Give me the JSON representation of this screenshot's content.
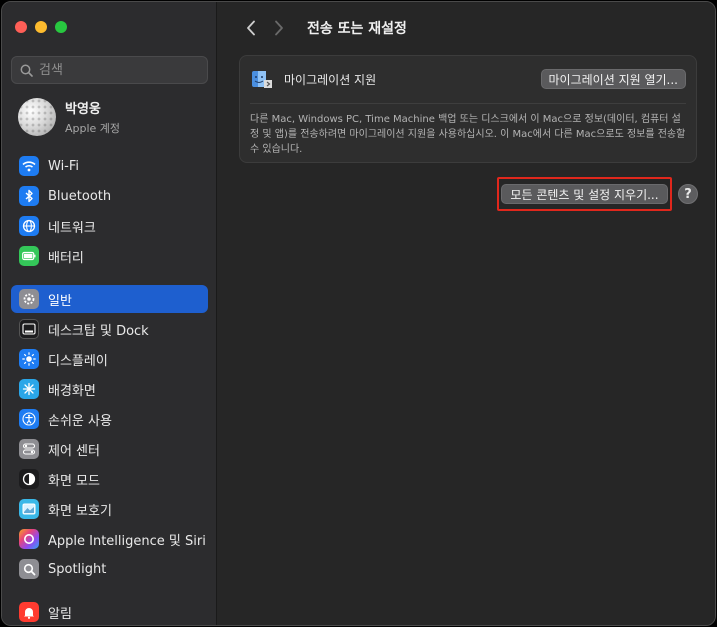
{
  "window": {
    "title": "전송 또는 재설정"
  },
  "search": {
    "placeholder": "검색"
  },
  "profile": {
    "name": "박영웅",
    "subtitle": "Apple 계정"
  },
  "sidebar": {
    "items": [
      {
        "label": "Wi-Fi",
        "icon": "wifi-icon",
        "color": "#1e7cf2"
      },
      {
        "label": "Bluetooth",
        "icon": "bluetooth-icon",
        "color": "#1e7cf2"
      },
      {
        "label": "네트워크",
        "icon": "globe-icon",
        "color": "#1e7cf2"
      },
      {
        "label": "배터리",
        "icon": "battery-icon",
        "color": "#34c759"
      },
      {
        "label": "일반",
        "icon": "gear-icon",
        "color": "#8e8e93",
        "selected": true
      },
      {
        "label": "데스크탑 및 Dock",
        "icon": "dock-icon",
        "color": "#1c1c1e"
      },
      {
        "label": "디스플레이",
        "icon": "sun-icon",
        "color": "#1e7cf2"
      },
      {
        "label": "배경화면",
        "icon": "wallpaper-icon",
        "color": "#2aa6e8"
      },
      {
        "label": "손쉬운 사용",
        "icon": "accessibility-icon",
        "color": "#1e7cf2"
      },
      {
        "label": "제어 센터",
        "icon": "control-center-icon",
        "color": "#8e8e93"
      },
      {
        "label": "화면 모드",
        "icon": "appearance-icon",
        "color": "#1c1c1e"
      },
      {
        "label": "화면 보호기",
        "icon": "screensaver-icon",
        "color": "#3ab8e8"
      },
      {
        "label": "Apple Intelligence 및 Siri",
        "icon": "siri-icon",
        "color": "#c94dd8"
      },
      {
        "label": "Spotlight",
        "icon": "spotlight-icon",
        "color": "#8e8e93"
      },
      {
        "label": "알림",
        "icon": "bell-icon",
        "color": "#ff3b30"
      }
    ]
  },
  "migration": {
    "label": "마이그레이션 지원",
    "button": "마이그레이션 지원 열기...",
    "description": "다른 Mac, Windows PC, Time Machine 백업 또는 디스크에서 이 Mac으로 정보(데이터, 컴퓨터 설정 및 앱)를 전송하려면 마이그레이션 지원을 사용하십시오. 이 Mac에서 다른 Mac으로도 정보를 전송할 수 있습니다."
  },
  "reset": {
    "button": "모든 콘텐츠 및 설정 지우기..."
  },
  "help": {
    "label": "?"
  },
  "colors": {
    "selection": "#1e5fcf",
    "highlight_box": "#e0271c"
  }
}
